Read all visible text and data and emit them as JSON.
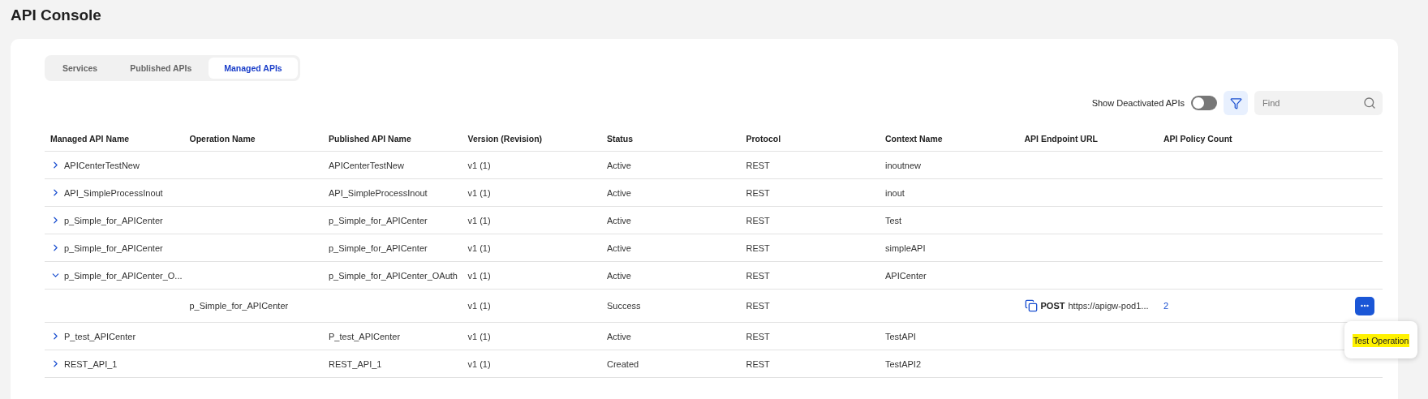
{
  "page": {
    "title": "API Console"
  },
  "tabs": [
    {
      "label": "Services",
      "selected": false
    },
    {
      "label": "Published APIs",
      "selected": false
    },
    {
      "label": "Managed APIs",
      "selected": true
    }
  ],
  "toolbar": {
    "toggle_label": "Show Deactivated APIs",
    "show_deactivated": false,
    "search": {
      "placeholder": "Find"
    }
  },
  "table": {
    "columns": [
      "Managed API Name",
      "Operation Name",
      "Published API Name",
      "Version (Revision)",
      "Status",
      "Protocol",
      "Context Name",
      "API Endpoint URL",
      "API Policy Count"
    ],
    "rows": [
      {
        "kind": "api",
        "expanded": false,
        "name": "APICenterTestNew",
        "published_api": "APICenterTestNew",
        "version": "v1 (1)",
        "status": "Active",
        "protocol": "REST",
        "context": "inoutnew"
      },
      {
        "kind": "api",
        "expanded": false,
        "name": "API_SimpleProcessInout",
        "published_api": "API_SimpleProcessInout",
        "version": "v1 (1)",
        "status": "Active",
        "protocol": "REST",
        "context": "inout"
      },
      {
        "kind": "api",
        "expanded": false,
        "name": "p_Simple_for_APICenter",
        "published_api": "p_Simple_for_APICenter",
        "version": "v1 (1)",
        "status": "Active",
        "protocol": "REST",
        "context": "Test"
      },
      {
        "kind": "api",
        "expanded": false,
        "name": "p_Simple_for_APICenter",
        "published_api": "p_Simple_for_APICenter",
        "version": "v1 (1)",
        "status": "Active",
        "protocol": "REST",
        "context": "simpleAPI"
      },
      {
        "kind": "api",
        "expanded": true,
        "name": "p_Simple_for_APICenter_O...",
        "published_api": "p_Simple_for_APICenter_OAuth",
        "version": "v1 (1)",
        "status": "Active",
        "protocol": "REST",
        "context": "APICenter",
        "children": [
          {
            "kind": "operation",
            "operation": "p_Simple_for_APICenter",
            "version": "v1 (1)",
            "status": "Success",
            "protocol": "REST",
            "method": "POST",
            "endpoint": "https://apigw-pod1...",
            "policy_count": "2",
            "menu": {
              "open": true,
              "items": [
                {
                  "label": "Test Operation",
                  "highlighted": true
                }
              ]
            }
          }
        ]
      },
      {
        "kind": "api",
        "expanded": false,
        "name": "P_test_APICenter",
        "published_api": "P_test_APICenter",
        "version": "v1 (1)",
        "status": "Active",
        "protocol": "REST",
        "context": "TestAPI"
      },
      {
        "kind": "api",
        "expanded": false,
        "name": "REST_API_1",
        "published_api": "REST_API_1",
        "version": "v1 (1)",
        "status": "Created",
        "protocol": "REST",
        "context": "TestAPI2"
      }
    ]
  }
}
